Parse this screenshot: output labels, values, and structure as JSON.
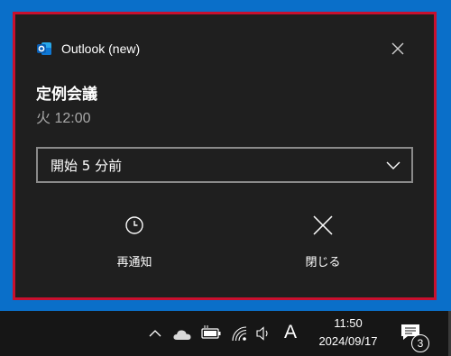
{
  "toast": {
    "app_name": "Outlook (new)",
    "title": "定例会議",
    "time": "火 12:00",
    "reminder_select": {
      "selected": "開始 5 分前"
    },
    "actions": {
      "snooze_label": "再通知",
      "dismiss_label": "閉じる"
    },
    "icons": {
      "app": "outlook-icon",
      "close": "close-icon",
      "chevron": "chevron-down-icon",
      "snooze": "clock-icon",
      "dismiss": "x-icon"
    }
  },
  "taskbar": {
    "ime_indicator": "A",
    "time": "11:50",
    "date": "2024/09/17",
    "notification_count": "3",
    "icons": [
      "chevron-up-icon",
      "onedrive-cloud-icon",
      "battery-icon",
      "wifi-icon",
      "speaker-icon",
      "notification-icon"
    ]
  },
  "colors": {
    "desktop": "#0a6fc9",
    "toast_bg": "#1f1f1f",
    "highlight_border": "#c8102e",
    "taskbar_bg": "#161616",
    "outlook_blue": "#0f78d4"
  }
}
